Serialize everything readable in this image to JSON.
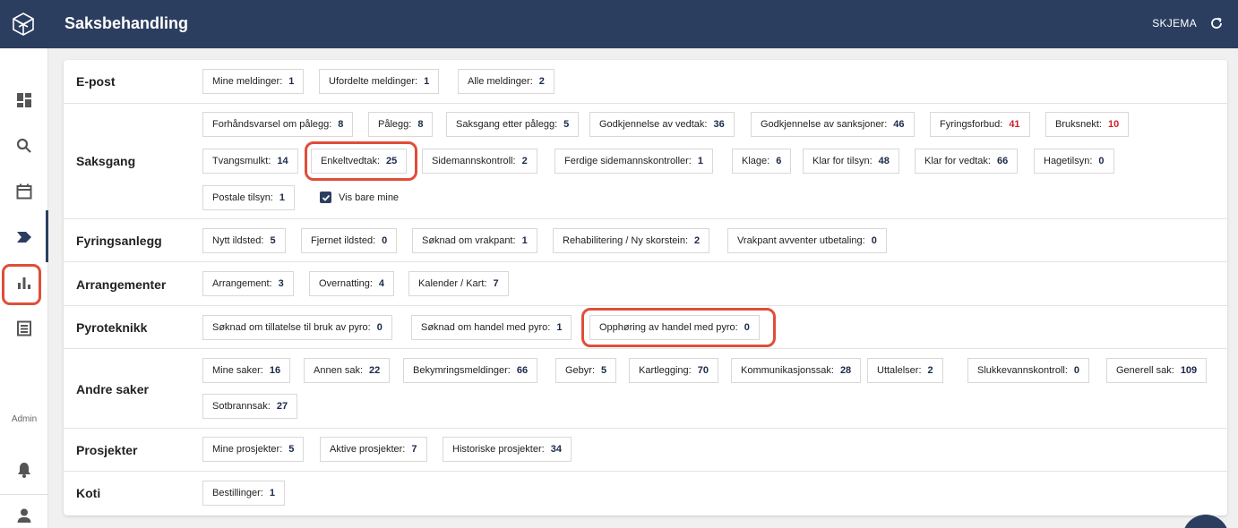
{
  "header": {
    "title": "Saksbehandling",
    "right_label": "SKJEMA",
    "logo_icon": "cube-logo-icon",
    "refresh_icon": "refresh-icon"
  },
  "sidebar": {
    "admin_label": "Admin",
    "active_color": "#2c3e60",
    "highlight_color": "#e04e38"
  },
  "sections": {
    "epost": {
      "label": "E-post",
      "chips": [
        {
          "label": "Mine meldinger:",
          "count": "1"
        },
        {
          "label": "Ufordelte meldinger:",
          "count": "1"
        },
        {
          "label": "Alle meldinger:",
          "count": "2"
        }
      ]
    },
    "saksgang": {
      "label": "Saksgang",
      "chips": [
        {
          "label": "Forhåndsvarsel om pålegg:",
          "count": "8"
        },
        {
          "label": "Pålegg:",
          "count": "8"
        },
        {
          "label": "Saksgang etter pålegg:",
          "count": "5"
        },
        {
          "label": "Godkjennelse av vedtak:",
          "count": "36"
        },
        {
          "label": "Godkjennelse av sanksjoner:",
          "count": "46"
        },
        {
          "label": "Fyringsforbud:",
          "count": "41"
        },
        {
          "label": "Bruksnekt:",
          "count": "10"
        },
        {
          "label": "Tvangsmulkt:",
          "count": "14"
        },
        {
          "label": "Enkeltvedtak:",
          "count": "25"
        },
        {
          "label": "Sidemannskontroll:",
          "count": "2"
        },
        {
          "label": "Ferdige sidemannskontroller:",
          "count": "1"
        },
        {
          "label": "Klage:",
          "count": "6"
        },
        {
          "label": "Klar for tilsyn:",
          "count": "48"
        },
        {
          "label": "Klar for vedtak:",
          "count": "66"
        },
        {
          "label": "Hagetilsyn:",
          "count": "0"
        },
        {
          "label": "Postale tilsyn:",
          "count": "1"
        }
      ],
      "checkbox_label": "Vis bare mine"
    },
    "fyring": {
      "label": "Fyringsanlegg",
      "chips": [
        {
          "label": "Nytt ildsted:",
          "count": "5"
        },
        {
          "label": "Fjernet ildsted:",
          "count": "0"
        },
        {
          "label": "Søknad om vrakpant:",
          "count": "1"
        },
        {
          "label": "Rehabilitering / Ny skorstein:",
          "count": "2"
        },
        {
          "label": "Vrakpant avventer utbetaling:",
          "count": "0"
        }
      ]
    },
    "arrangementer": {
      "label": "Arrangementer",
      "chips": [
        {
          "label": "Arrangement:",
          "count": "3"
        },
        {
          "label": "Overnatting:",
          "count": "4"
        },
        {
          "label": "Kalender / Kart:",
          "count": "7"
        }
      ]
    },
    "pyro": {
      "label": "Pyroteknikk",
      "chips": [
        {
          "label": "Søknad om tillatelse til bruk av pyro:",
          "count": "0"
        },
        {
          "label": "Søknad om handel med pyro:",
          "count": "1"
        },
        {
          "label": "Opphøring av handel med pyro:",
          "count": "0"
        }
      ]
    },
    "andre": {
      "label": "Andre saker",
      "chips": [
        {
          "label": "Mine saker:",
          "count": "16"
        },
        {
          "label": "Annen sak:",
          "count": "22"
        },
        {
          "label": "Bekymringsmeldinger:",
          "count": "66"
        },
        {
          "label": "Gebyr:",
          "count": "5"
        },
        {
          "label": "Kartlegging:",
          "count": "70"
        },
        {
          "label": "Kommunikasjonssak:",
          "count": "28"
        },
        {
          "label": "Uttalelser:",
          "count": "2"
        },
        {
          "label": "Slukkevannskontroll:",
          "count": "0"
        },
        {
          "label": "Generell sak:",
          "count": "109"
        },
        {
          "label": "Sotbrannsak:",
          "count": "27"
        }
      ]
    },
    "prosjekter": {
      "label": "Prosjekter",
      "chips": [
        {
          "label": "Mine prosjekter:",
          "count": "5"
        },
        {
          "label": "Aktive prosjekter:",
          "count": "7"
        },
        {
          "label": "Historiske prosjekter:",
          "count": "34"
        }
      ]
    },
    "koti": {
      "label": "Koti",
      "chips": [
        {
          "label": "Bestillinger:",
          "count": "1"
        }
      ]
    }
  }
}
